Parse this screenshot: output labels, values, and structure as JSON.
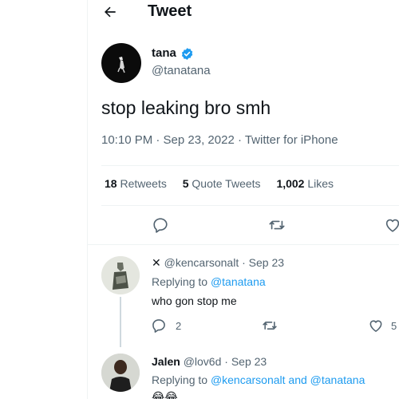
{
  "header": {
    "title": "Tweet"
  },
  "tweet": {
    "author_name": "tana",
    "author_handle": "@tanatana",
    "text": "stop leaking bro smh",
    "meta": "10:10 PM · Sep 23, 2022 · Twitter for iPhone",
    "stats": {
      "retweets_count": "18",
      "retweets_label": "Retweets",
      "quotes_count": "5",
      "quotes_label": "Quote Tweets",
      "likes_count": "1,002",
      "likes_label": "Likes"
    }
  },
  "replies": [
    {
      "name_prefix": "✕",
      "handle": "@kencarsonalt",
      "date": "· Sep 23",
      "replying_label": "Replying to",
      "mentions": "@tanatana",
      "text": "who gon stop me",
      "reply_count": "2",
      "like_count": "5"
    },
    {
      "name": "Jalen",
      "handle": "@lov6d",
      "date": "· Sep 23",
      "replying_label": "Replying to",
      "mentions": "@kencarsonalt and @tanatana",
      "text": "😂😂"
    }
  ],
  "icons": [
    "arrow-left-icon",
    "verified-badge-icon",
    "reply-icon",
    "retweet-icon",
    "like-icon"
  ],
  "colors": {
    "accent": "#1d9bf0",
    "secondary_text": "#536471",
    "border": "#eff3f4"
  }
}
